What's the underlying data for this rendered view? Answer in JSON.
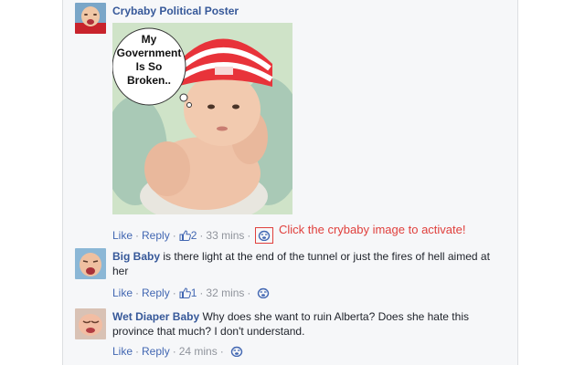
{
  "post": {
    "author": "Crybaby Political Poster",
    "image_caption_lines": [
      "My",
      "Government",
      "Is So",
      "Broken.."
    ],
    "actions": {
      "like": "Like",
      "reply": "Reply",
      "like_count": "2",
      "time": "33 mins"
    },
    "hint": "Click the crybaby image to activate!"
  },
  "comments": [
    {
      "author": "Big Baby",
      "text_line1": "is there light at the end of the tunnel or just the fires of hell aimed at",
      "text_line2": "her",
      "like": "Like",
      "reply": "Reply",
      "like_count": "1",
      "time": "32 mins"
    },
    {
      "author": "Wet Diaper Baby",
      "text_line1": "Why does she want to ruin Alberta? Does she hate this",
      "text_line2": "province that much? I don't understand.",
      "like": "Like",
      "reply": "Reply",
      "time": "24 mins"
    }
  ],
  "icons": {
    "like": "thumbs-up-icon",
    "crybaby": "crybaby-face-icon"
  },
  "colors": {
    "link": "#365899",
    "action": "#4267b2",
    "hint": "#e0403d"
  }
}
